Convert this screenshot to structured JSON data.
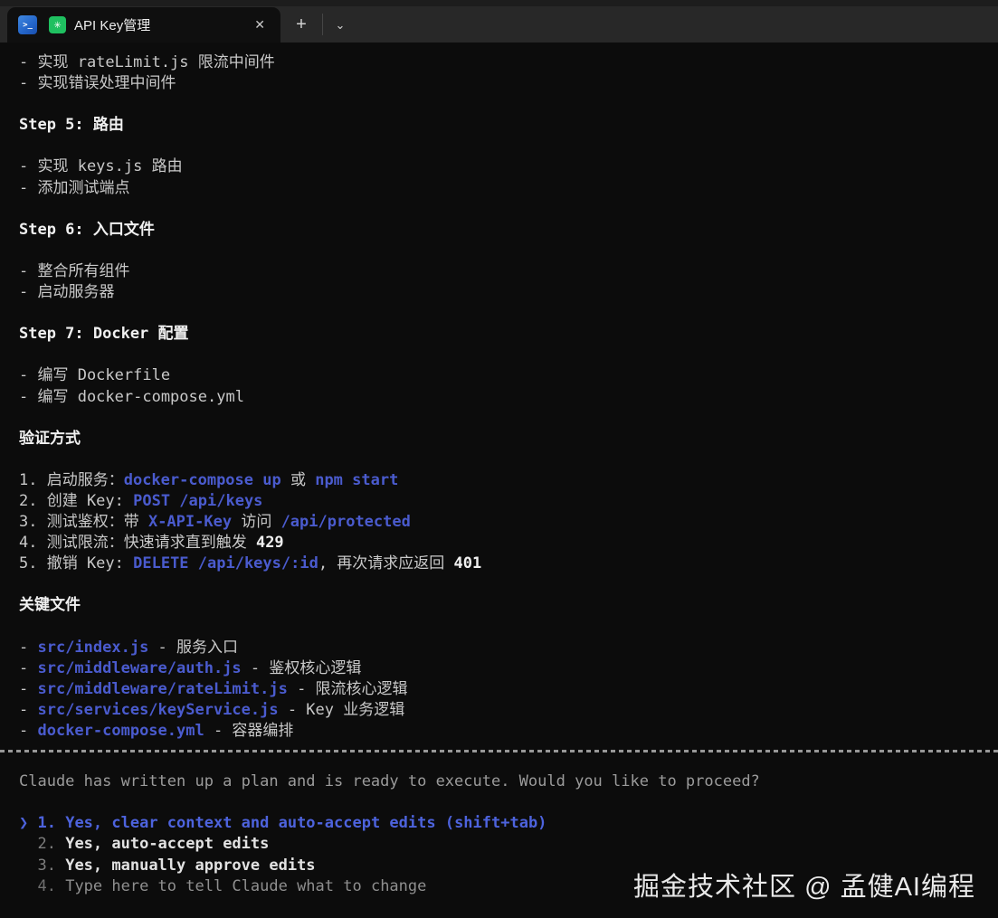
{
  "tab_bar": {
    "title": "API Key管理",
    "close_label": "✕",
    "new_tab_label": "+",
    "dropdown_label": "⌄",
    "powershell_icon_glyph": ">_",
    "claude_icon_glyph": "✳"
  },
  "colors": {
    "terminal_background": "#0c0c0c",
    "tabbar_background": "#282828",
    "normal_text": "#c9c9c9",
    "bold_text": "#f0f0f0",
    "accent_blue": "#4a5bce",
    "menu_selected_blue": "#4d63dd",
    "dim_text": "#8f8f8f",
    "powershell_icon_blue": "#2364c8",
    "claude_icon_green": "#1fc060"
  },
  "terminal": {
    "lines": [
      {
        "segments": [
          {
            "text": "- 实现 rateLimit.js 限流中间件",
            "style": "normal"
          }
        ]
      },
      {
        "segments": [
          {
            "text": "- 实现错误处理中间件",
            "style": "normal"
          }
        ]
      },
      {
        "segments": [
          {
            "text": " ",
            "style": "normal"
          }
        ]
      },
      {
        "segments": [
          {
            "text": "Step 5: 路由",
            "style": "bold"
          }
        ]
      },
      {
        "segments": [
          {
            "text": " ",
            "style": "normal"
          }
        ]
      },
      {
        "segments": [
          {
            "text": "- 实现 keys.js 路由",
            "style": "normal"
          }
        ]
      },
      {
        "segments": [
          {
            "text": "- 添加测试端点",
            "style": "normal"
          }
        ]
      },
      {
        "segments": [
          {
            "text": " ",
            "style": "normal"
          }
        ]
      },
      {
        "segments": [
          {
            "text": "Step 6: 入口文件",
            "style": "bold"
          }
        ]
      },
      {
        "segments": [
          {
            "text": " ",
            "style": "normal"
          }
        ]
      },
      {
        "segments": [
          {
            "text": "- 整合所有组件",
            "style": "normal"
          }
        ]
      },
      {
        "segments": [
          {
            "text": "- 启动服务器",
            "style": "normal"
          }
        ]
      },
      {
        "segments": [
          {
            "text": " ",
            "style": "normal"
          }
        ]
      },
      {
        "segments": [
          {
            "text": "Step 7: Docker 配置",
            "style": "bold"
          }
        ]
      },
      {
        "segments": [
          {
            "text": " ",
            "style": "normal"
          }
        ]
      },
      {
        "segments": [
          {
            "text": "- 编写 Dockerfile",
            "style": "normal"
          }
        ]
      },
      {
        "segments": [
          {
            "text": "- 编写 docker-compose.yml",
            "style": "normal"
          }
        ]
      },
      {
        "segments": [
          {
            "text": " ",
            "style": "normal"
          }
        ]
      },
      {
        "segments": [
          {
            "text": "验证方式",
            "style": "bold"
          }
        ]
      },
      {
        "segments": [
          {
            "text": " ",
            "style": "normal"
          }
        ]
      },
      {
        "segments": [
          {
            "text": "1. 启动服务：",
            "style": "normal"
          },
          {
            "text": "docker-compose up",
            "style": "blue"
          },
          {
            "text": " 或 ",
            "style": "normal"
          },
          {
            "text": "npm start",
            "style": "blue"
          }
        ]
      },
      {
        "segments": [
          {
            "text": "2. 创建 Key: ",
            "style": "normal"
          },
          {
            "text": "POST /api/keys",
            "style": "blue"
          }
        ]
      },
      {
        "segments": [
          {
            "text": "3. 测试鉴权：带 ",
            "style": "normal"
          },
          {
            "text": "X-API-Key",
            "style": "blue"
          },
          {
            "text": " 访问 ",
            "style": "normal"
          },
          {
            "text": "/api/protected",
            "style": "blue"
          }
        ]
      },
      {
        "segments": [
          {
            "text": "4. 测试限流：快速请求直到触发 ",
            "style": "normal"
          },
          {
            "text": "429",
            "style": "bold"
          }
        ]
      },
      {
        "segments": [
          {
            "text": "5. 撤销 Key: ",
            "style": "normal"
          },
          {
            "text": "DELETE /api/keys/:id",
            "style": "blue"
          },
          {
            "text": ", 再次请求应返回 ",
            "style": "normal"
          },
          {
            "text": "401",
            "style": "bold"
          }
        ]
      },
      {
        "segments": [
          {
            "text": " ",
            "style": "normal"
          }
        ]
      },
      {
        "segments": [
          {
            "text": "关键文件",
            "style": "bold"
          }
        ]
      },
      {
        "segments": [
          {
            "text": " ",
            "style": "normal"
          }
        ]
      },
      {
        "segments": [
          {
            "text": "- ",
            "style": "normal"
          },
          {
            "text": "src/index.js",
            "style": "blue"
          },
          {
            "text": " - 服务入口",
            "style": "normal"
          }
        ]
      },
      {
        "segments": [
          {
            "text": "- ",
            "style": "normal"
          },
          {
            "text": "src/middleware/auth.js",
            "style": "blue"
          },
          {
            "text": " - 鉴权核心逻辑",
            "style": "normal"
          }
        ]
      },
      {
        "segments": [
          {
            "text": "- ",
            "style": "normal"
          },
          {
            "text": "src/middleware/rateLimit.js",
            "style": "blue"
          },
          {
            "text": " - 限流核心逻辑",
            "style": "normal"
          }
        ]
      },
      {
        "segments": [
          {
            "text": "- ",
            "style": "normal"
          },
          {
            "text": "src/services/keyService.js",
            "style": "blue"
          },
          {
            "text": " - Key 业务逻辑",
            "style": "normal"
          }
        ]
      },
      {
        "segments": [
          {
            "text": "- ",
            "style": "normal"
          },
          {
            "text": "docker-compose.yml",
            "style": "blue"
          },
          {
            "text": " - 容器编排",
            "style": "normal"
          }
        ]
      }
    ]
  },
  "prompt": {
    "text": "Claude has written up a plan and is ready to execute. Would you like to proceed?"
  },
  "menu": {
    "options": [
      {
        "pointer": "❯ ",
        "number": "1. ",
        "text": "Yes, clear context and auto-accept edits (shift+tab)",
        "state": "selected"
      },
      {
        "pointer": "  ",
        "number": "2. ",
        "text": "Yes, auto-accept edits",
        "state": "normal"
      },
      {
        "pointer": "  ",
        "number": "3. ",
        "text": "Yes, manually approve edits",
        "state": "normal"
      },
      {
        "pointer": "  ",
        "number": "4. ",
        "text": "Type here to tell Claude what to change",
        "state": "dim"
      }
    ]
  },
  "watermark": {
    "text": "掘金技术社区 @ 孟健AI编程"
  }
}
